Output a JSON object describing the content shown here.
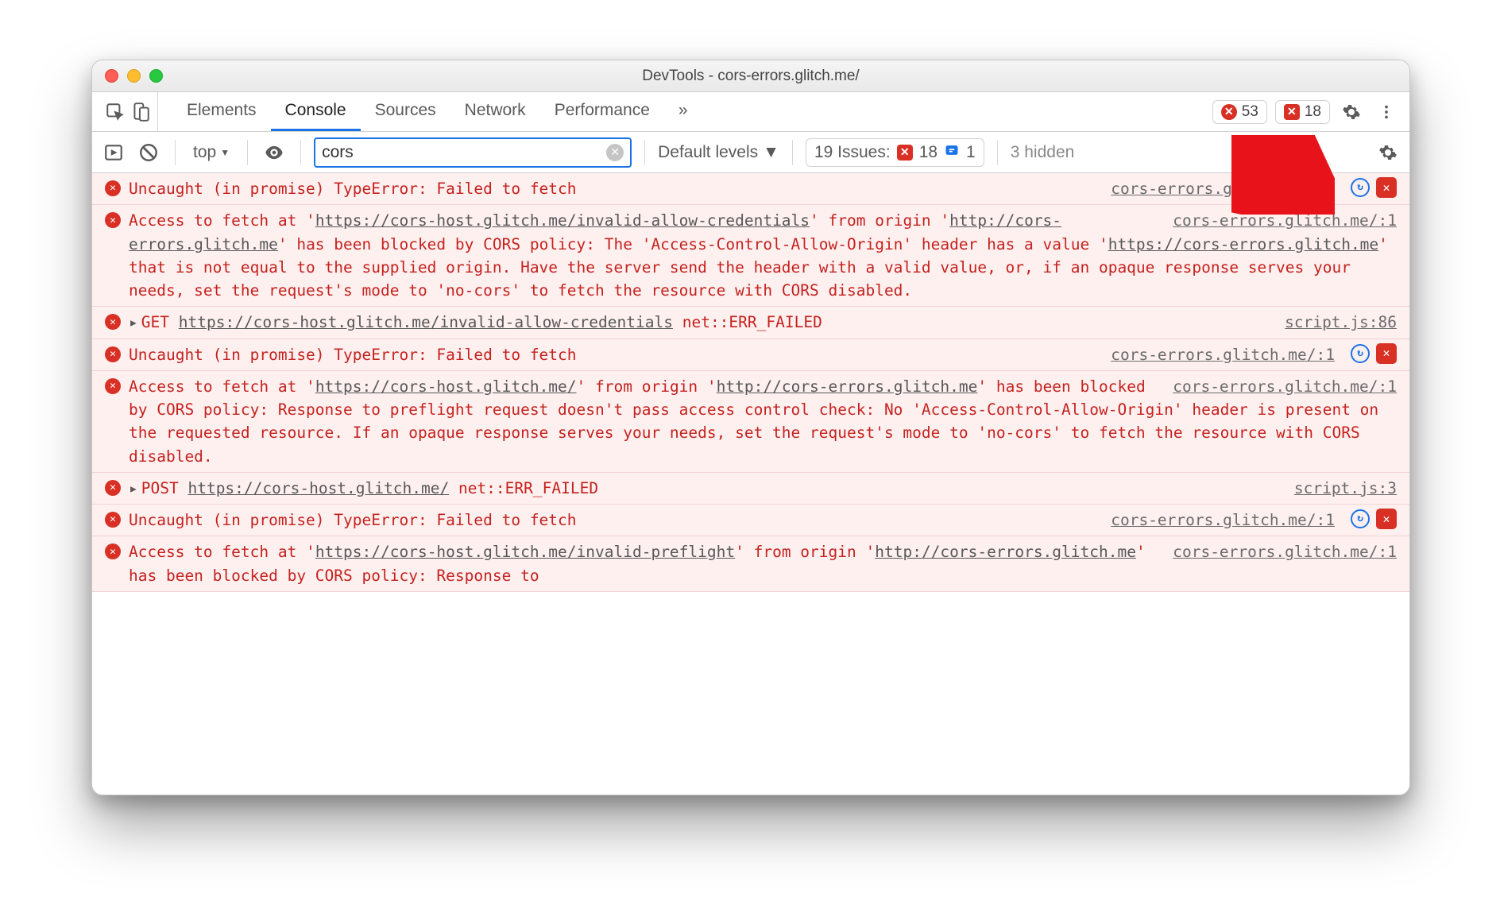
{
  "window": {
    "title": "DevTools - cors-errors.glitch.me/"
  },
  "tabs": {
    "items": [
      "Elements",
      "Console",
      "Sources",
      "Network",
      "Performance"
    ],
    "more": "»",
    "badges": {
      "errors": "53",
      "issues": "18"
    }
  },
  "toolbar": {
    "context": "top",
    "filter_value": "cors",
    "levels": "Default levels",
    "issues_label": "19 Issues:",
    "issues_errors": "18",
    "issues_info": "1",
    "hidden": "3 hidden"
  },
  "src": {
    "origin1": "cors-errors.glitch.me/:1",
    "script86": "script.js:86",
    "script3": "script.js:3"
  },
  "messages": {
    "typeerror": "Uncaught (in promise) TypeError: Failed to fetch",
    "m2_a": "Access to fetch at '",
    "m2_url1": "https://cors-host.glitch.me/invalid-allow-credentials",
    "m2_b": "' from origin '",
    "m2_url2": "http://cors-errors.glitch.me",
    "m2_c": "' has been blocked by CORS policy: The 'Access-Control-Allow-Origin' header has a value '",
    "m2_url3": "https://cors-errors.glitch.me",
    "m2_d": "' that is not equal to the supplied origin. Have the server send the header with a valid value, or, if an opaque response serves your needs, set the request's mode to 'no-cors' to fetch the resource with CORS disabled.",
    "m3_method": "GET",
    "m3_url": "https://cors-host.glitch.me/invalid-allow-credentials",
    "m3_err": "net::ERR_FAILED",
    "m5_a": "Access to fetch at '",
    "m5_url1": "https://cors-host.glitch.me/",
    "m5_b": "' from origin '",
    "m5_url2": "http://cors-errors.glitch.me",
    "m5_c": "' has been blocked by CORS policy: Response to preflight request doesn't pass access control check: No 'Access-Control-Allow-Origin' header is present on the requested resource. If an opaque response serves your needs, set the request's mode to 'no-cors' to fetch the resource with CORS disabled.",
    "m6_method": "POST",
    "m6_url": "https://cors-host.glitch.me/",
    "m6_err": "net::ERR_FAILED",
    "m8_a": "Access to fetch at '",
    "m8_url1": "https://cors-host.glitch.me/invalid-preflight",
    "m8_b": "' from origin '",
    "m8_url2": "http://cors-errors.glitch.me",
    "m8_c": "' has been blocked by CORS policy: Response to"
  }
}
